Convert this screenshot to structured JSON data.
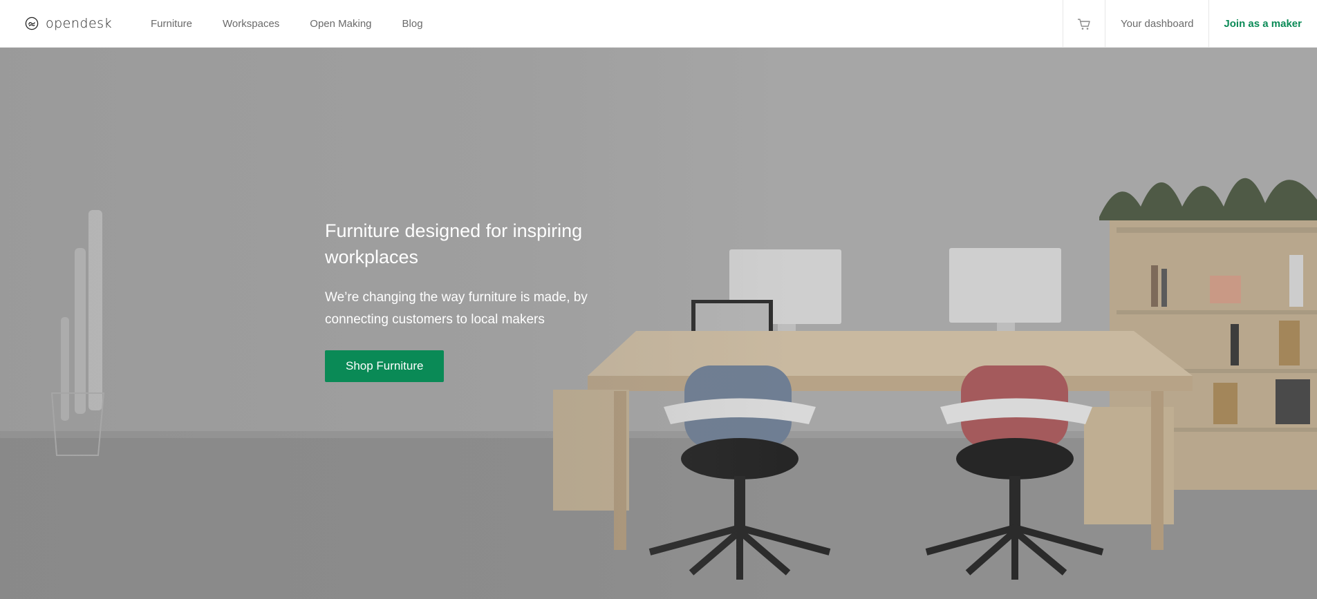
{
  "brand": {
    "name": "opendesk",
    "logo_icon": "opendesk-logo-icon"
  },
  "nav": {
    "items": [
      "Furniture",
      "Workspaces",
      "Open Making",
      "Blog"
    ]
  },
  "header_right": {
    "cart_icon": "cart-icon",
    "dashboard_label": "Your dashboard",
    "join_label": "Join as a maker"
  },
  "hero": {
    "title": "Furniture designed for inspiring workplaces",
    "subtitle": "We’re changing the way furniture is made, by connecting customers to local makers",
    "cta_label": "Shop Furniture"
  },
  "colors": {
    "accent": "#0a8a56",
    "nav_text": "#6a6a6a"
  }
}
